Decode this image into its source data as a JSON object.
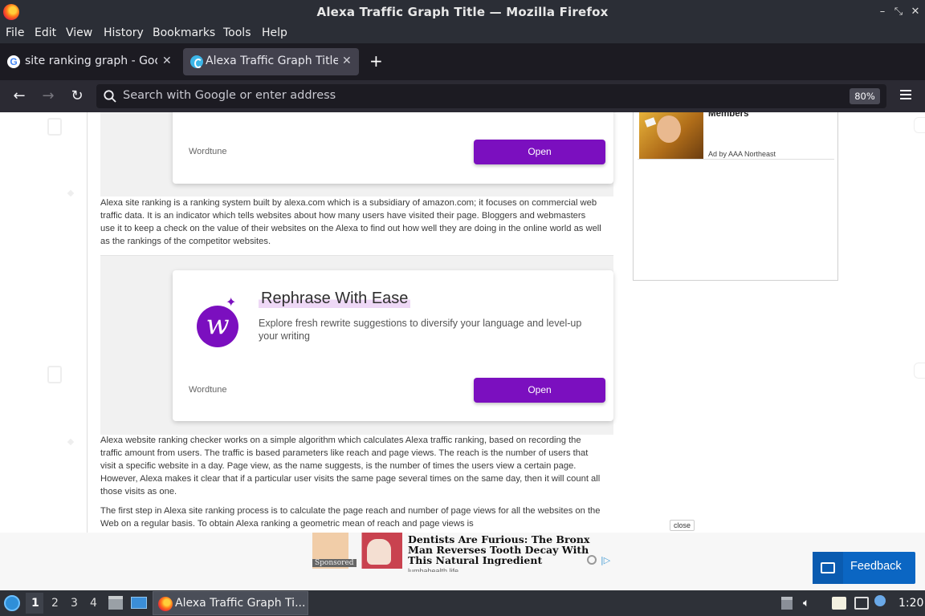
{
  "window": {
    "title": "Alexa Traffic Graph Title — Mozilla Firefox"
  },
  "menu": [
    "File",
    "Edit",
    "View",
    "History",
    "Bookmarks",
    "Tools",
    "Help"
  ],
  "tabs": [
    {
      "label": "site ranking graph - Google",
      "active": false,
      "icon": "google-icon"
    },
    {
      "label": "Alexa Traffic Graph Title",
      "active": true,
      "icon": "site-icon"
    }
  ],
  "nav": {
    "search_placeholder": "Search with Google or enter address",
    "zoom": "80%"
  },
  "content": {
    "ad1": {
      "brand": "Wordtune",
      "button": "Open"
    },
    "para1": "Alexa site ranking is a ranking system built by alexa.com which is a subsidiary of amazon.com; it focuses on commercial web traffic data. It is an indicator which tells websites about how many users have visited their page. Bloggers and webmasters use it to keep a check on the value of their websites on the Alexa to find out how well they are doing in the online world as well as the rankings of the competitor websites.",
    "ad2": {
      "title": "Rephrase With Ease",
      "description": "Explore fresh rewrite suggestions to diversify your language and level-up your writing",
      "logo_letter": "w",
      "brand": "Wordtune",
      "button": "Open"
    },
    "para2": "Alexa website ranking checker works on a simple algorithm which calculates Alexa traffic ranking, based on recording the traffic amount from users. The traffic is based parameters like reach and page views. The reach is the number of users that visit a specific website in a day. Page view, as the name suggests, is the number of times the users view a certain page. However, Alexa makes it clear that if a particular user visits the same page several times on the same day, then it will count all those visits as one.",
    "para3": "The first step in Alexa site ranking process is to calculate the page reach and number of page views for all the websites on the Web on a regular basis. To obtain Alexa ranking a geometric mean of reach and page views is"
  },
  "sidebar_ad": {
    "headline": "Members",
    "ad_by": "Ad by AAA Northeast"
  },
  "bottom_ad": {
    "close": "close",
    "sponsored": "Sponsored",
    "headline": "Dentists Are Furious: The Bronx Man Reverses Tooth Decay With This Natural Ingredient",
    "source": "lumbahealth.life"
  },
  "feedback": {
    "label": "Feedback"
  },
  "taskbar": {
    "workspaces": [
      "1",
      "2",
      "3",
      "4"
    ],
    "active_workspace": "1",
    "task_label": "Alexa Traffic Graph Ti...",
    "clock": "1:20"
  },
  "colors": {
    "accent_purple": "#7b0fbf",
    "feedback_blue": "#0b66c3",
    "chrome_dark": "#2b2e36"
  }
}
